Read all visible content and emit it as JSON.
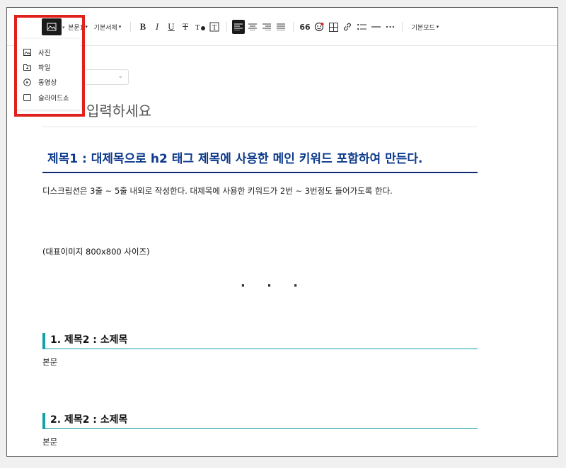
{
  "toolbar": {
    "paragraph_style": "본문1",
    "font": "기본서체",
    "quote": "66",
    "mode": "기본모드"
  },
  "image_menu": {
    "items": [
      {
        "label": "사진",
        "icon": "photo-icon"
      },
      {
        "label": "파일",
        "icon": "file-icon"
      },
      {
        "label": "동영상",
        "icon": "video-icon"
      },
      {
        "label": "슬라이드쇼",
        "icon": "slideshow-icon"
      }
    ]
  },
  "editor": {
    "title_placeholder_visible": "입력하세요",
    "h2": "제목1 : 대제목으로 h2 태그 제목에 사용한 메인 키워드 포함하여 만든다.",
    "description": "디스크립션은 3줄 ~ 5줄 내외로 작성한다. 대제목에 사용한 키워드가 2번 ~ 3번정도 들어가도록 한다.",
    "rep_image_note": "(대표이미지 800x800 사이즈)",
    "separator": "· · ·",
    "sections": [
      {
        "heading": "1. 제목2 : 소제목",
        "body": "본문"
      },
      {
        "heading": "2. 제목2 : 소제목",
        "body": "본문"
      }
    ]
  },
  "colors": {
    "highlight": "#e0201d",
    "h2_text": "#0d3a8c",
    "h3_accent": "#16a0a8"
  }
}
